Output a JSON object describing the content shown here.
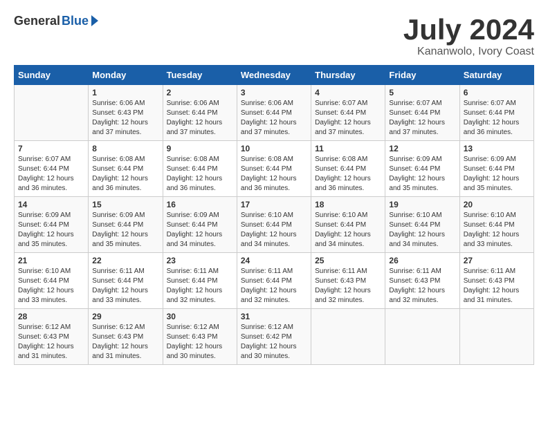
{
  "header": {
    "logo_general": "General",
    "logo_blue": "Blue",
    "month_title": "July 2024",
    "location": "Kananwolo, Ivory Coast"
  },
  "days_of_week": [
    "Sunday",
    "Monday",
    "Tuesday",
    "Wednesday",
    "Thursday",
    "Friday",
    "Saturday"
  ],
  "weeks": [
    [
      {
        "day": "",
        "sunrise": "",
        "sunset": "",
        "daylight": ""
      },
      {
        "day": "1",
        "sunrise": "6:06 AM",
        "sunset": "6:43 PM",
        "daylight": "12 hours and 37 minutes."
      },
      {
        "day": "2",
        "sunrise": "6:06 AM",
        "sunset": "6:44 PM",
        "daylight": "12 hours and 37 minutes."
      },
      {
        "day": "3",
        "sunrise": "6:06 AM",
        "sunset": "6:44 PM",
        "daylight": "12 hours and 37 minutes."
      },
      {
        "day": "4",
        "sunrise": "6:07 AM",
        "sunset": "6:44 PM",
        "daylight": "12 hours and 37 minutes."
      },
      {
        "day": "5",
        "sunrise": "6:07 AM",
        "sunset": "6:44 PM",
        "daylight": "12 hours and 37 minutes."
      },
      {
        "day": "6",
        "sunrise": "6:07 AM",
        "sunset": "6:44 PM",
        "daylight": "12 hours and 36 minutes."
      }
    ],
    [
      {
        "day": "7",
        "sunrise": "6:07 AM",
        "sunset": "6:44 PM",
        "daylight": "12 hours and 36 minutes."
      },
      {
        "day": "8",
        "sunrise": "6:08 AM",
        "sunset": "6:44 PM",
        "daylight": "12 hours and 36 minutes."
      },
      {
        "day": "9",
        "sunrise": "6:08 AM",
        "sunset": "6:44 PM",
        "daylight": "12 hours and 36 minutes."
      },
      {
        "day": "10",
        "sunrise": "6:08 AM",
        "sunset": "6:44 PM",
        "daylight": "12 hours and 36 minutes."
      },
      {
        "day": "11",
        "sunrise": "6:08 AM",
        "sunset": "6:44 PM",
        "daylight": "12 hours and 36 minutes."
      },
      {
        "day": "12",
        "sunrise": "6:09 AM",
        "sunset": "6:44 PM",
        "daylight": "12 hours and 35 minutes."
      },
      {
        "day": "13",
        "sunrise": "6:09 AM",
        "sunset": "6:44 PM",
        "daylight": "12 hours and 35 minutes."
      }
    ],
    [
      {
        "day": "14",
        "sunrise": "6:09 AM",
        "sunset": "6:44 PM",
        "daylight": "12 hours and 35 minutes."
      },
      {
        "day": "15",
        "sunrise": "6:09 AM",
        "sunset": "6:44 PM",
        "daylight": "12 hours and 35 minutes."
      },
      {
        "day": "16",
        "sunrise": "6:09 AM",
        "sunset": "6:44 PM",
        "daylight": "12 hours and 34 minutes."
      },
      {
        "day": "17",
        "sunrise": "6:10 AM",
        "sunset": "6:44 PM",
        "daylight": "12 hours and 34 minutes."
      },
      {
        "day": "18",
        "sunrise": "6:10 AM",
        "sunset": "6:44 PM",
        "daylight": "12 hours and 34 minutes."
      },
      {
        "day": "19",
        "sunrise": "6:10 AM",
        "sunset": "6:44 PM",
        "daylight": "12 hours and 34 minutes."
      },
      {
        "day": "20",
        "sunrise": "6:10 AM",
        "sunset": "6:44 PM",
        "daylight": "12 hours and 33 minutes."
      }
    ],
    [
      {
        "day": "21",
        "sunrise": "6:10 AM",
        "sunset": "6:44 PM",
        "daylight": "12 hours and 33 minutes."
      },
      {
        "day": "22",
        "sunrise": "6:11 AM",
        "sunset": "6:44 PM",
        "daylight": "12 hours and 33 minutes."
      },
      {
        "day": "23",
        "sunrise": "6:11 AM",
        "sunset": "6:44 PM",
        "daylight": "12 hours and 32 minutes."
      },
      {
        "day": "24",
        "sunrise": "6:11 AM",
        "sunset": "6:44 PM",
        "daylight": "12 hours and 32 minutes."
      },
      {
        "day": "25",
        "sunrise": "6:11 AM",
        "sunset": "6:43 PM",
        "daylight": "12 hours and 32 minutes."
      },
      {
        "day": "26",
        "sunrise": "6:11 AM",
        "sunset": "6:43 PM",
        "daylight": "12 hours and 32 minutes."
      },
      {
        "day": "27",
        "sunrise": "6:11 AM",
        "sunset": "6:43 PM",
        "daylight": "12 hours and 31 minutes."
      }
    ],
    [
      {
        "day": "28",
        "sunrise": "6:12 AM",
        "sunset": "6:43 PM",
        "daylight": "12 hours and 31 minutes."
      },
      {
        "day": "29",
        "sunrise": "6:12 AM",
        "sunset": "6:43 PM",
        "daylight": "12 hours and 31 minutes."
      },
      {
        "day": "30",
        "sunrise": "6:12 AM",
        "sunset": "6:43 PM",
        "daylight": "12 hours and 30 minutes."
      },
      {
        "day": "31",
        "sunrise": "6:12 AM",
        "sunset": "6:42 PM",
        "daylight": "12 hours and 30 minutes."
      },
      {
        "day": "",
        "sunrise": "",
        "sunset": "",
        "daylight": ""
      },
      {
        "day": "",
        "sunrise": "",
        "sunset": "",
        "daylight": ""
      },
      {
        "day": "",
        "sunrise": "",
        "sunset": "",
        "daylight": ""
      }
    ]
  ]
}
